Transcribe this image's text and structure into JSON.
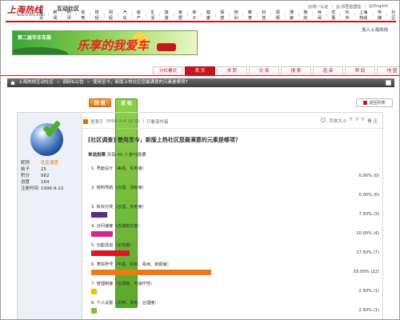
{
  "header": {
    "logo_text": "上海热线",
    "logo_sub": "www.online.sh.cn",
    "site_name": "互动社区",
    "top_links": [
      "统一认证",
      "邻居首登陆",
      "English"
    ],
    "nav": [
      "首页",
      "新闻",
      "时评",
      "体育",
      "财经",
      "财经",
      "汽车",
      "房产",
      "生活",
      "旅游",
      "家居",
      "亲子",
      "健康",
      "情感",
      "培训",
      "教育",
      "科技",
      "视频",
      "搜索",
      "我的",
      "休闲",
      "优惠",
      "伙伴",
      "上海热线",
      "传媒",
      "社区"
    ],
    "join_link": "加入上海热线"
  },
  "banner": {
    "title": "第二届华东车展",
    "big_text": "乐享的我爱车"
  },
  "tabs": [
    {
      "label": "分栏模式",
      "active": false
    },
    {
      "label": "首 页",
      "active": true
    },
    {
      "label": "求 职",
      "active": false
    },
    {
      "label": "交 易",
      "active": false
    },
    {
      "label": "搜 索",
      "active": false
    },
    {
      "label": "道 具",
      "active": false
    },
    {
      "label": "帮 助",
      "active": false
    },
    {
      "label": "地 图",
      "active": false
    }
  ],
  "breadcrumb": [
    "上海热线互动社区",
    "调研&公告",
    "使用至今，新版上热社区您最满意的元素是哪项?"
  ],
  "buttons": {
    "reply": "回 复",
    "post": "发 帖",
    "back": "返回列表"
  },
  "user": {
    "nickname_label": "昵称",
    "nickname": "社区调查",
    "posts_label": "帖子",
    "posts": "25",
    "points_label": "积分",
    "points": "982",
    "level_label": "进度",
    "level": "164",
    "reg_label": "注册时间",
    "reg_date": "1996-9-22"
  },
  "post": {
    "meta_prefix": "发表于",
    "date": "2009-3-4 16:51",
    "only_author": "只看该作者",
    "tools": [
      "打印",
      "字体大小",
      "T",
      "T",
      "T"
    ],
    "reply_icon_label": "看 正",
    "title": "[社区调查] 使用至今，新版上热社区您最满意的元素是哪项？",
    "poll_mode": "单选投票",
    "poll_stats": "共有 40 人参与投票"
  },
  "poll": {
    "options": [
      {
        "label": "1. 界面设计（美观、实用度）",
        "percent": 0.0,
        "votes": 0,
        "color": "#cccccc",
        "text": "0.00% (0)"
      },
      {
        "label": "2. 结构导航（合理、清晰度）",
        "percent": 0.0,
        "votes": 0,
        "color": "#cccccc",
        "text": "0.00% (0)"
      },
      {
        "label": "3. 板块分类（合理、实用度）",
        "percent": 7.5,
        "votes": 3,
        "color": "#5a2b8a",
        "text": "7.50% (3)"
      },
      {
        "label": "4. 访问速度（快捷稳定度）",
        "percent": 10.0,
        "votes": 4,
        "color": "#d6278b",
        "text": "10.00% (4)"
      },
      {
        "label": "5. 功能改进（实用度）",
        "percent": 17.5,
        "votes": 7,
        "color": "#d9162a",
        "text": "17.50% (7)"
      },
      {
        "label": "6. 表情符号（丰富、实用、易用、新颖度）",
        "percent": 55.0,
        "votes": 22,
        "color": "#ee7a12",
        "text": "55.00% (22)"
      },
      {
        "label": "7. 管理制度（合理度、可操作性）",
        "percent": 2.5,
        "votes": 1,
        "color": "#f2c200",
        "text": "2.50% (1)"
      },
      {
        "label": "8. 个人设置（实用、易用、合理度）",
        "percent": 2.5,
        "votes": 1,
        "color": "#7dc23b",
        "text": "2.50% (1)"
      }
    ]
  },
  "colors": {
    "brand": "#c8161d",
    "sidebar_bg": "#edf1f7"
  }
}
